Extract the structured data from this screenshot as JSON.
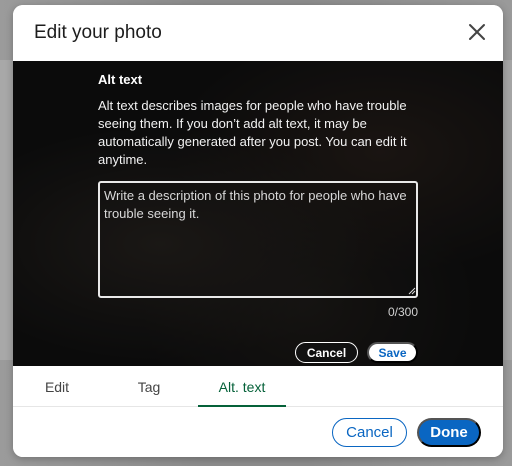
{
  "modal": {
    "title": "Edit your photo",
    "close_icon": "close-icon"
  },
  "alt_text": {
    "heading": "Alt text",
    "description": "Alt text describes images for people who have trouble seeing them. If you don’t add alt text, it may be automatically generated after you post. You can edit it anytime.",
    "placeholder": "Write a description of this photo for people who have trouble seeing it.",
    "value": "",
    "char_count": "0/300",
    "cancel_label": "Cancel",
    "save_label": "Save"
  },
  "tabs": [
    {
      "label": "Edit",
      "active": false
    },
    {
      "label": "Tag",
      "active": false
    },
    {
      "label": "Alt. text",
      "active": true
    }
  ],
  "footer": {
    "cancel_label": "Cancel",
    "done_label": "Done"
  },
  "colors": {
    "accent": "#0a66c2",
    "active_tab": "#056139",
    "photo_overlay": "#000000"
  }
}
